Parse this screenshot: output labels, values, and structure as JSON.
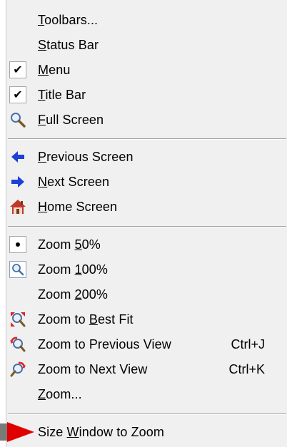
{
  "menu": {
    "items": [
      {
        "id": "toolbars",
        "pre": "",
        "u": "T",
        "post": "oolbars...",
        "icon": "none",
        "shortcut": ""
      },
      {
        "id": "status-bar",
        "pre": "",
        "u": "S",
        "post": "tatus Bar",
        "icon": "none",
        "shortcut": ""
      },
      {
        "id": "menu",
        "pre": "",
        "u": "M",
        "post": "enu",
        "icon": "checkmark",
        "shortcut": ""
      },
      {
        "id": "title-bar",
        "pre": "",
        "u": "T",
        "post": "itle Bar",
        "icon": "checkmark",
        "shortcut": ""
      },
      {
        "id": "full-screen",
        "pre": "",
        "u": "F",
        "post": "ull Screen",
        "icon": "magnifier",
        "shortcut": ""
      },
      {
        "id": "previous-screen",
        "pre": "",
        "u": "P",
        "post": "revious Screen",
        "icon": "left-arrow",
        "shortcut": ""
      },
      {
        "id": "next-screen",
        "pre": "",
        "u": "N",
        "post": "ext Screen",
        "icon": "right-arrow",
        "shortcut": ""
      },
      {
        "id": "home-screen",
        "pre": "",
        "u": "H",
        "post": "ome Screen",
        "icon": "house",
        "shortcut": ""
      },
      {
        "id": "zoom-50",
        "pre": "Zoom ",
        "u": "5",
        "post": "0%",
        "icon": "radio-bullet",
        "shortcut": ""
      },
      {
        "id": "zoom-100",
        "pre": "Zoom ",
        "u": "1",
        "post": "00%",
        "icon": "zoom-magnifier",
        "shortcut": ""
      },
      {
        "id": "zoom-200",
        "pre": "Zoom ",
        "u": "2",
        "post": "00%",
        "icon": "none",
        "shortcut": ""
      },
      {
        "id": "zoom-best-fit",
        "pre": "Zoom to ",
        "u": "B",
        "post": "est Fit",
        "icon": "best-fit",
        "shortcut": ""
      },
      {
        "id": "zoom-previous-view",
        "pre": "Zoom to Previous View",
        "u": "",
        "post": "",
        "icon": "previous-view",
        "shortcut": "Ctrl+J"
      },
      {
        "id": "zoom-next-view",
        "pre": "Zoom to Next View",
        "u": "",
        "post": "",
        "icon": "next-view",
        "shortcut": "Ctrl+K"
      },
      {
        "id": "zoom-dialog",
        "pre": "",
        "u": "Z",
        "post": "oom...",
        "icon": "none",
        "shortcut": ""
      },
      {
        "id": "size-window",
        "pre": "Size ",
        "u": "W",
        "post": "indow to Zoom",
        "icon": "none",
        "shortcut": ""
      }
    ]
  },
  "colors": {
    "menu_bg": "#f0f0f0",
    "arrow_blue": "#1e3fd8",
    "highlight_red": "#e00000",
    "house_red": "#c0392b"
  }
}
